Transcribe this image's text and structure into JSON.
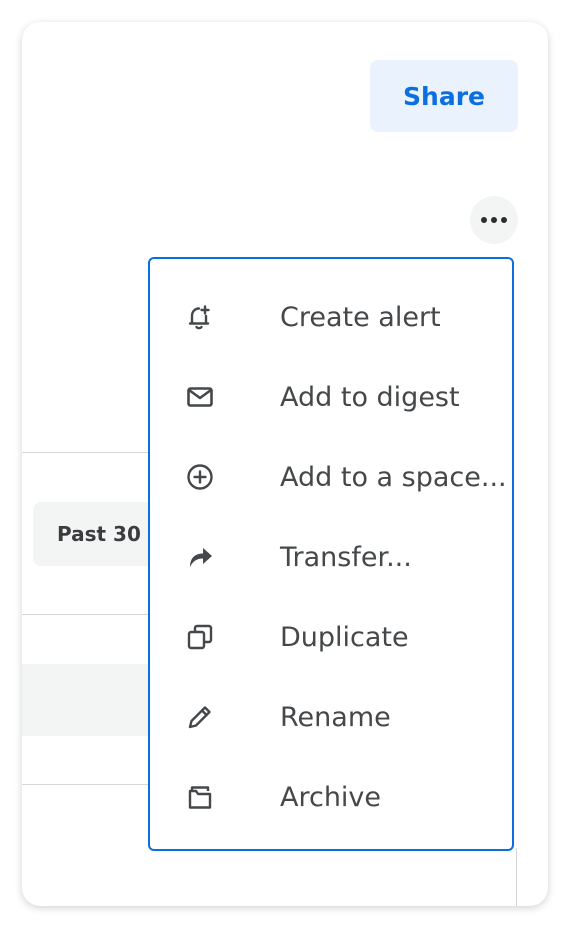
{
  "header": {
    "share_label": "Share"
  },
  "filter": {
    "date_range_label": "Past 30"
  },
  "more_menu": {
    "items": [
      {
        "label": "Create alert",
        "icon": "bell-plus-icon"
      },
      {
        "label": "Add to digest",
        "icon": "envelope-icon"
      },
      {
        "label": "Add to a space...",
        "icon": "plus-circle-icon"
      },
      {
        "label": "Transfer...",
        "icon": "share-arrow-icon"
      },
      {
        "label": "Duplicate",
        "icon": "duplicate-icon"
      },
      {
        "label": "Rename",
        "icon": "pencil-icon"
      },
      {
        "label": "Archive",
        "icon": "archive-box-icon"
      }
    ]
  },
  "colors": {
    "accent": "#0b6fe0",
    "accent_bg": "#eaf3fd",
    "text": "#45484a",
    "surface_grey": "#f3f5f5"
  }
}
